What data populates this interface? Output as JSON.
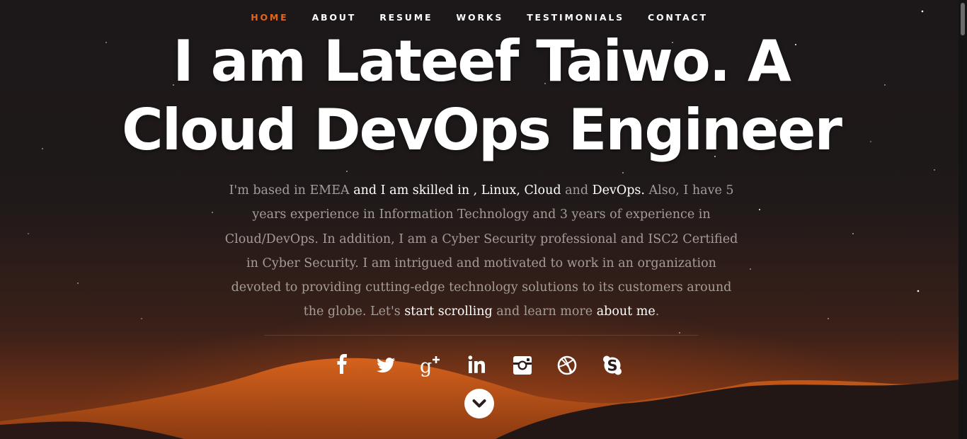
{
  "nav": {
    "items": [
      {
        "label": "HOME",
        "active": true
      },
      {
        "label": "ABOUT",
        "active": false
      },
      {
        "label": "RESUME",
        "active": false
      },
      {
        "label": "WORKS",
        "active": false
      },
      {
        "label": "TESTIMONIALS",
        "active": false
      },
      {
        "label": "CONTACT",
        "active": false
      }
    ],
    "active_color": "#e2651f"
  },
  "hero": {
    "headline_line1": "I am Lateef Taiwo. A",
    "headline_line2": "Cloud DevOps Engineer",
    "about": {
      "s1": "I'm based in EMEA",
      "s2": " and I am skilled in ,",
      "s3": " Linux,",
      "s4": " Cloud",
      "s5": " and ",
      "s6": "DevOps.",
      "s7": " Also, I have 5 years experience in Information Technology and 3 years of experience in Cloud/DevOps. In addition, I am a Cyber Security professional and ISC2 Certified in Cyber Security. I am intrigued and motivated to work in an organization devoted to providing cutting-edge technology solutions to its customers around the globe. Let's ",
      "link_scroll": "start scrolling",
      "s8": " and learn more ",
      "link_about": "about me",
      "s9": "."
    }
  },
  "social": {
    "icons": [
      "facebook-icon",
      "twitter-icon",
      "google-plus-icon",
      "linkedin-icon",
      "instagram-icon",
      "dribbble-icon",
      "skype-icon"
    ]
  },
  "scroll_button": {
    "icon": "chevron-down-icon"
  },
  "colors": {
    "accent": "#e2651f",
    "text_muted": "#a59c98",
    "background": "#1b1718"
  }
}
